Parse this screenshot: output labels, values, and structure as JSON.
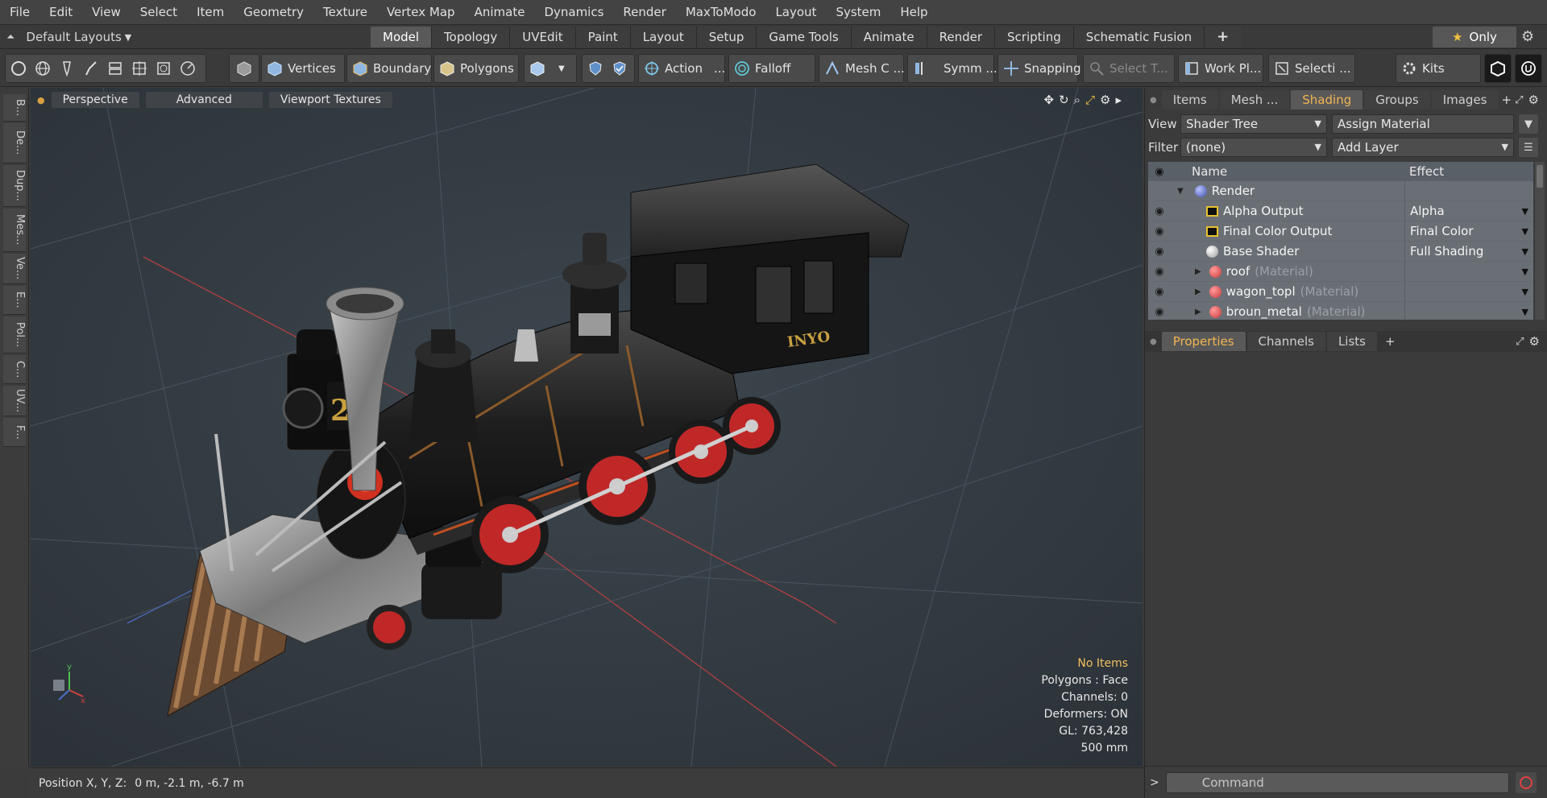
{
  "menu": [
    "File",
    "Edit",
    "View",
    "Select",
    "Item",
    "Geometry",
    "Texture",
    "Vertex Map",
    "Animate",
    "Dynamics",
    "Render",
    "MaxToModo",
    "Layout",
    "System",
    "Help"
  ],
  "layoutbar": {
    "layouts_label": "Default Layouts",
    "tabs": [
      "Model",
      "Topology",
      "UVEdit",
      "Paint",
      "Layout",
      "Setup",
      "Game Tools",
      "Animate",
      "Render",
      "Scripting",
      "Schematic Fusion"
    ],
    "active_tab": "Model",
    "add_label": "+",
    "only_label": "Only"
  },
  "toolbar": {
    "vertices": "Vertices",
    "boundary": "Boundary",
    "polygons": "Polygons",
    "action": "Action",
    "action_more": "...",
    "falloff": "Falloff",
    "mesh": "Mesh C ...",
    "symm": "Symm ...",
    "snapping": "Snapping",
    "select_t": "Select T...",
    "work_plane": "Work Pl...",
    "selecti": "Selecti ...",
    "kits": "Kits"
  },
  "leftstrip": [
    "B...",
    "De...",
    "Dup...",
    "Mes...",
    "Ve...",
    "E...",
    "Pol...",
    "C...",
    "UV...",
    "F..."
  ],
  "viewport": {
    "perspective": "Perspective",
    "advanced": "Advanced",
    "viewport_textures": "Viewport Textures",
    "plate_number": "22",
    "cab_lettering": "INYO",
    "info": {
      "no_items": "No Items",
      "polygons": "Polygons : Face",
      "channels": "Channels: 0",
      "deformers": "Deformers: ON",
      "gl": "GL: 763,428",
      "scale": "500 mm"
    }
  },
  "status": {
    "position_label": "Position X, Y, Z:",
    "position_value": "0 m, -2.1 m, -6.7 m"
  },
  "panel": {
    "tabs": [
      "Items",
      "Mesh ...",
      "Shading",
      "Groups",
      "Images"
    ],
    "active_tab": "Shading",
    "view_label": "View",
    "view_value": "Shader Tree",
    "assign_material": "Assign Material",
    "filter_label": "Filter",
    "filter_value": "(none)",
    "add_layer": "Add Layer",
    "col_name": "Name",
    "col_effect": "Effect",
    "tree": [
      {
        "name": "Render",
        "suffix": "",
        "effect": "",
        "icon": "render-sphere-icon",
        "color": "#3c4fa8",
        "indent": 1
      },
      {
        "name": "Alpha Output",
        "suffix": "",
        "effect": "Alpha",
        "icon": "output-icon",
        "color": "#e8c030",
        "indent": 2
      },
      {
        "name": "Final Color Output",
        "suffix": "",
        "effect": "Final Color",
        "icon": "output-icon",
        "color": "#e8c030",
        "indent": 2
      },
      {
        "name": "Base Shader",
        "suffix": "",
        "effect": "Full Shading",
        "icon": "shader-sphere-icon",
        "color": "#e8e8e8",
        "indent": 2
      },
      {
        "name": "roof",
        "suffix": "(Material)",
        "effect": "",
        "icon": "material-icon",
        "color": "#c83a3a",
        "indent": 2
      },
      {
        "name": "wagon_topl",
        "suffix": "(Material)",
        "effect": "",
        "icon": "material-icon",
        "color": "#c83a3a",
        "indent": 2
      },
      {
        "name": "broun_metal",
        "suffix": "(Material)",
        "effect": "",
        "icon": "material-icon",
        "color": "#c83a3a",
        "indent": 2
      }
    ],
    "prop_tabs": [
      "Properties",
      "Channels",
      "Lists"
    ],
    "prop_active": "Properties",
    "command_placeholder": "Command"
  }
}
